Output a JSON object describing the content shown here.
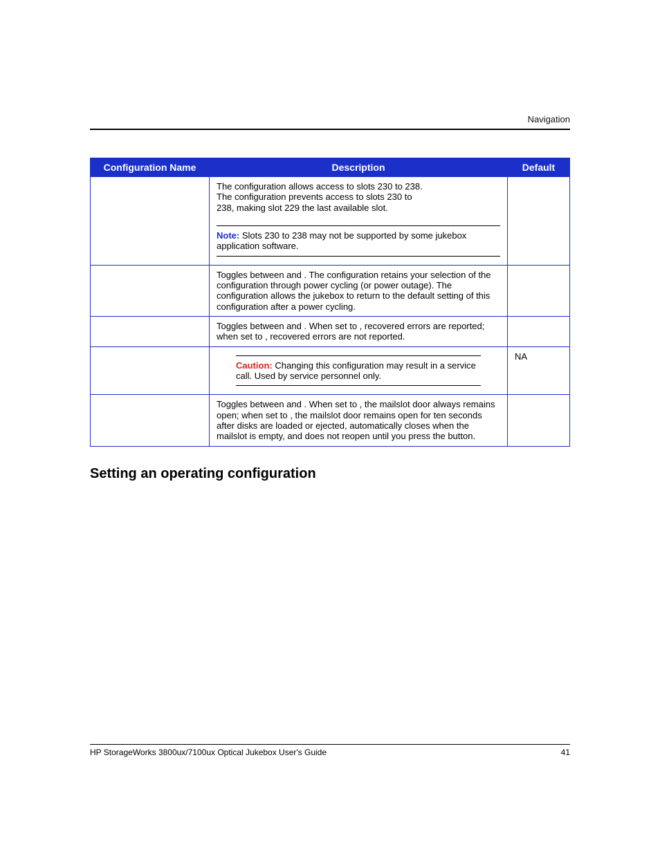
{
  "header": {
    "running_head": "Navigation"
  },
  "table": {
    "headers": {
      "col1": "Configuration Name",
      "col2": "Description",
      "col3": "Default"
    },
    "rows": [
      {
        "name": "",
        "default": "",
        "desc": {
          "line1_a": "The ",
          "line1_b": " configuration allows access to slots 230 to 238.",
          "line2_a": "The ",
          "line2_b": " configuration prevents access to slots 230 to",
          "line3": "238, making slot 229 the last available slot.",
          "note_label": "Note:",
          "note_text": "  Slots 230 to 238 may not be supported by some jukebox application software."
        }
      },
      {
        "name": "",
        "default": "",
        "desc_text": "Toggles between       and      . The       configuration retains your selection of the                 configuration through power cycling (or power outage). The       configuration allows the jukebox to return to the default setting of this configuration after a power cycling."
      },
      {
        "name": "",
        "default": "",
        "desc_text": "Toggles between       and      . When set to      , recovered errors are reported; when set to       , recovered errors are not reported."
      },
      {
        "name": "",
        "default": "NA",
        "caution_label": "Caution:",
        "caution_text": "  Changing this configuration may result in a service call. Used by service personnel only."
      },
      {
        "name": "",
        "default": "",
        "desc_text": "Toggles between         and         . When set to       , the mailslot door always remains open; when set to          , the mailslot door remains open for ten seconds after disks are loaded or ejected, automatically closes when the mailslot is empty, and does not reopen until you press the          button."
      }
    ]
  },
  "section_heading": "Setting an operating configuration",
  "footer": {
    "doc_title": "HP StorageWorks 3800ux/7100ux Optical Jukebox User's Guide",
    "page_number": "41"
  }
}
